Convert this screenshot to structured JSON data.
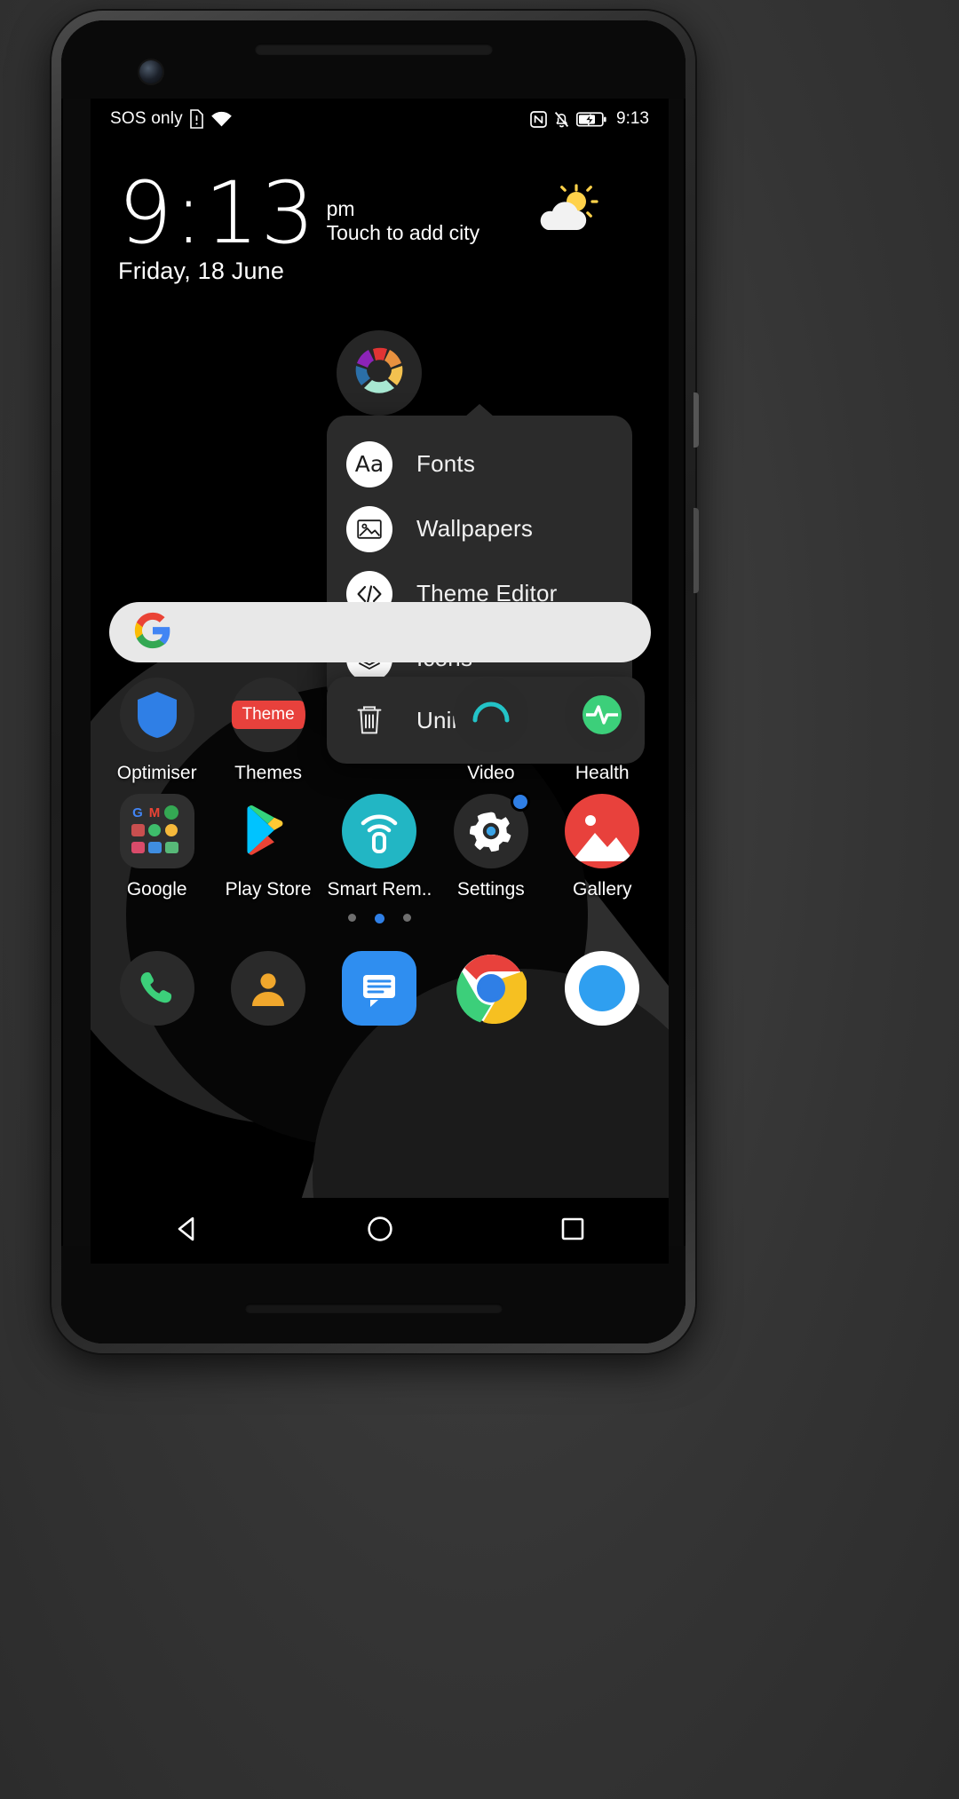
{
  "status_bar": {
    "carrier": "SOS only",
    "sim_icon": "sim-alert-icon",
    "wifi_icon": "wifi-icon",
    "nfc_icon": "nfc-icon",
    "mute_icon": "bell-off-icon",
    "battery_icon": "battery-charging-icon",
    "clock": "9:13"
  },
  "clock_widget": {
    "time": "9:13",
    "ampm": "pm",
    "city_hint": "Touch to add city",
    "date": "Friday, 18 June",
    "weather_icon": "sun-behind-cloud-icon"
  },
  "search": {
    "icon": "google-g-icon",
    "placeholder": ""
  },
  "popup_menu": {
    "items": [
      {
        "label": "Fonts",
        "icon": "font-aa-icon",
        "glyph": "Aa"
      },
      {
        "label": "Wallpapers",
        "icon": "image-picture-icon"
      },
      {
        "label": "Theme Editor",
        "icon": "code-brackets-icon"
      },
      {
        "label": "Icons",
        "icon": "layers-stack-icon"
      }
    ]
  },
  "uninstall_menu": {
    "label": "Uninstall",
    "icon": "trash-bin-icon"
  },
  "home_screen": {
    "row1": [
      {
        "label": "Optimiser",
        "icon": "shield-icon"
      },
      {
        "label": "Themes",
        "icon": "themes-icon"
      },
      {
        "label": "",
        "icon": "hidden-icon"
      },
      {
        "label": "Video",
        "icon": "video-icon"
      },
      {
        "label": "Health",
        "icon": "health-icon"
      }
    ],
    "row2": [
      {
        "label": "Google",
        "icon": "google-folder-icon"
      },
      {
        "label": "Play Store",
        "icon": "play-store-icon"
      },
      {
        "label": "Smart Rem..",
        "icon": "smart-remote-icon"
      },
      {
        "label": "Settings",
        "icon": "settings-gear-icon"
      },
      {
        "label": "Gallery",
        "icon": "gallery-icon"
      }
    ],
    "page_dots": {
      "count": 3,
      "active_index": 1
    },
    "dock": [
      {
        "label": "Phone",
        "icon": "phone-icon"
      },
      {
        "label": "Contacts",
        "icon": "contacts-person-icon"
      },
      {
        "label": "Messages",
        "icon": "messages-icon"
      },
      {
        "label": "Chrome",
        "icon": "chrome-icon"
      },
      {
        "label": "Browser",
        "icon": "blue-circle-icon"
      }
    ]
  },
  "nav_bar": {
    "back": "back-triangle-icon",
    "home": "home-circle-icon",
    "recents": "recents-square-icon"
  },
  "colors": {
    "accent_blue": "#2f7fe6",
    "panel": "#2b2b2b",
    "screen_bg": "#000000",
    "search_bg": "#e8e8e8"
  }
}
